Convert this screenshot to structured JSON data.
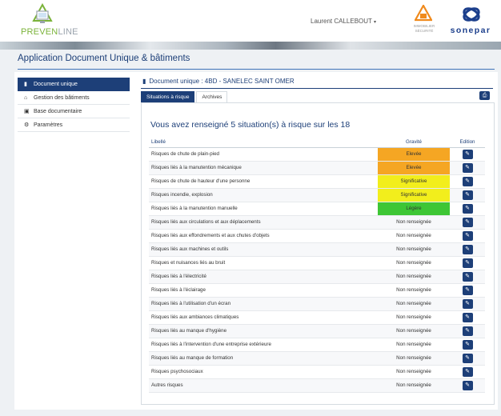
{
  "header": {
    "logo_prev": "PREVEN",
    "logo_line": "LINE",
    "user_name": "Laurent CALLEBOUT",
    "immo_logo_text": "IMMOBILIER SÉCURITÉ",
    "sonepar_text": "sonepar"
  },
  "app_title": "Application Document Unique & bâtiments",
  "sidebar": {
    "items": [
      {
        "label": "Document unique",
        "icon": "file-icon",
        "active": true
      },
      {
        "label": "Gestion des bâtiments",
        "icon": "home-icon",
        "active": false
      },
      {
        "label": "Base documentaire",
        "icon": "book-icon",
        "active": false
      },
      {
        "label": "Paramètres",
        "icon": "gear-icon",
        "active": false
      }
    ]
  },
  "document_title": "Document unique : 4BD - SANELEC SAINT OMER",
  "tabs": [
    {
      "label": "Situations à risque",
      "active": true
    },
    {
      "label": "Archives",
      "active": false
    }
  ],
  "summary": "Vous avez renseigné 5 situation(s) à risque sur les 18",
  "table": {
    "headers": {
      "label": "Libellé",
      "gravity": "Gravité",
      "edit": "Edition"
    },
    "rows": [
      {
        "label": "Risques de chute de plain-pied",
        "gravity": "Elevée",
        "color": "#f5a623"
      },
      {
        "label": "Risques liés à la manutention mécanique",
        "gravity": "Elevée",
        "color": "#f5a623"
      },
      {
        "label": "Risques de chute de hauteur d'une personne",
        "gravity": "Significative",
        "color": "#f2ee1c"
      },
      {
        "label": "Risques incendie, explosion",
        "gravity": "Significative",
        "color": "#f2ee1c"
      },
      {
        "label": "Risques liés à la manutention manuelle",
        "gravity": "Légère",
        "color": "#3ec635"
      },
      {
        "label": "Risques liés aux circulations et aux déplacements",
        "gravity": "Non renseignée",
        "color": ""
      },
      {
        "label": "Risques liés aux effondrements et aux chutes d'objets",
        "gravity": "Non renseignée",
        "color": ""
      },
      {
        "label": "Risques liés aux machines et outils",
        "gravity": "Non renseignée",
        "color": ""
      },
      {
        "label": "Risques et nuisances liés au bruit",
        "gravity": "Non renseignée",
        "color": ""
      },
      {
        "label": "Risques liés à l'électricité",
        "gravity": "Non renseignée",
        "color": ""
      },
      {
        "label": "Risques liés à l'éclairage",
        "gravity": "Non renseignée",
        "color": ""
      },
      {
        "label": "Risques liés à l'utilisation d'un écran",
        "gravity": "Non renseignée",
        "color": ""
      },
      {
        "label": "Risques liés aux ambiances climatiques",
        "gravity": "Non renseignée",
        "color": ""
      },
      {
        "label": "Risques liés au manque d'hygiène",
        "gravity": "Non renseignée",
        "color": ""
      },
      {
        "label": "Risques liés à l'intervention d'une entreprise extérieure",
        "gravity": "Non renseignée",
        "color": ""
      },
      {
        "label": "Risques liés au manque de formation",
        "gravity": "Non renseignée",
        "color": ""
      },
      {
        "label": "Risques psychosociaux",
        "gravity": "Non renseignée",
        "color": ""
      },
      {
        "label": "Autres risques",
        "gravity": "Non renseignée",
        "color": ""
      }
    ]
  }
}
